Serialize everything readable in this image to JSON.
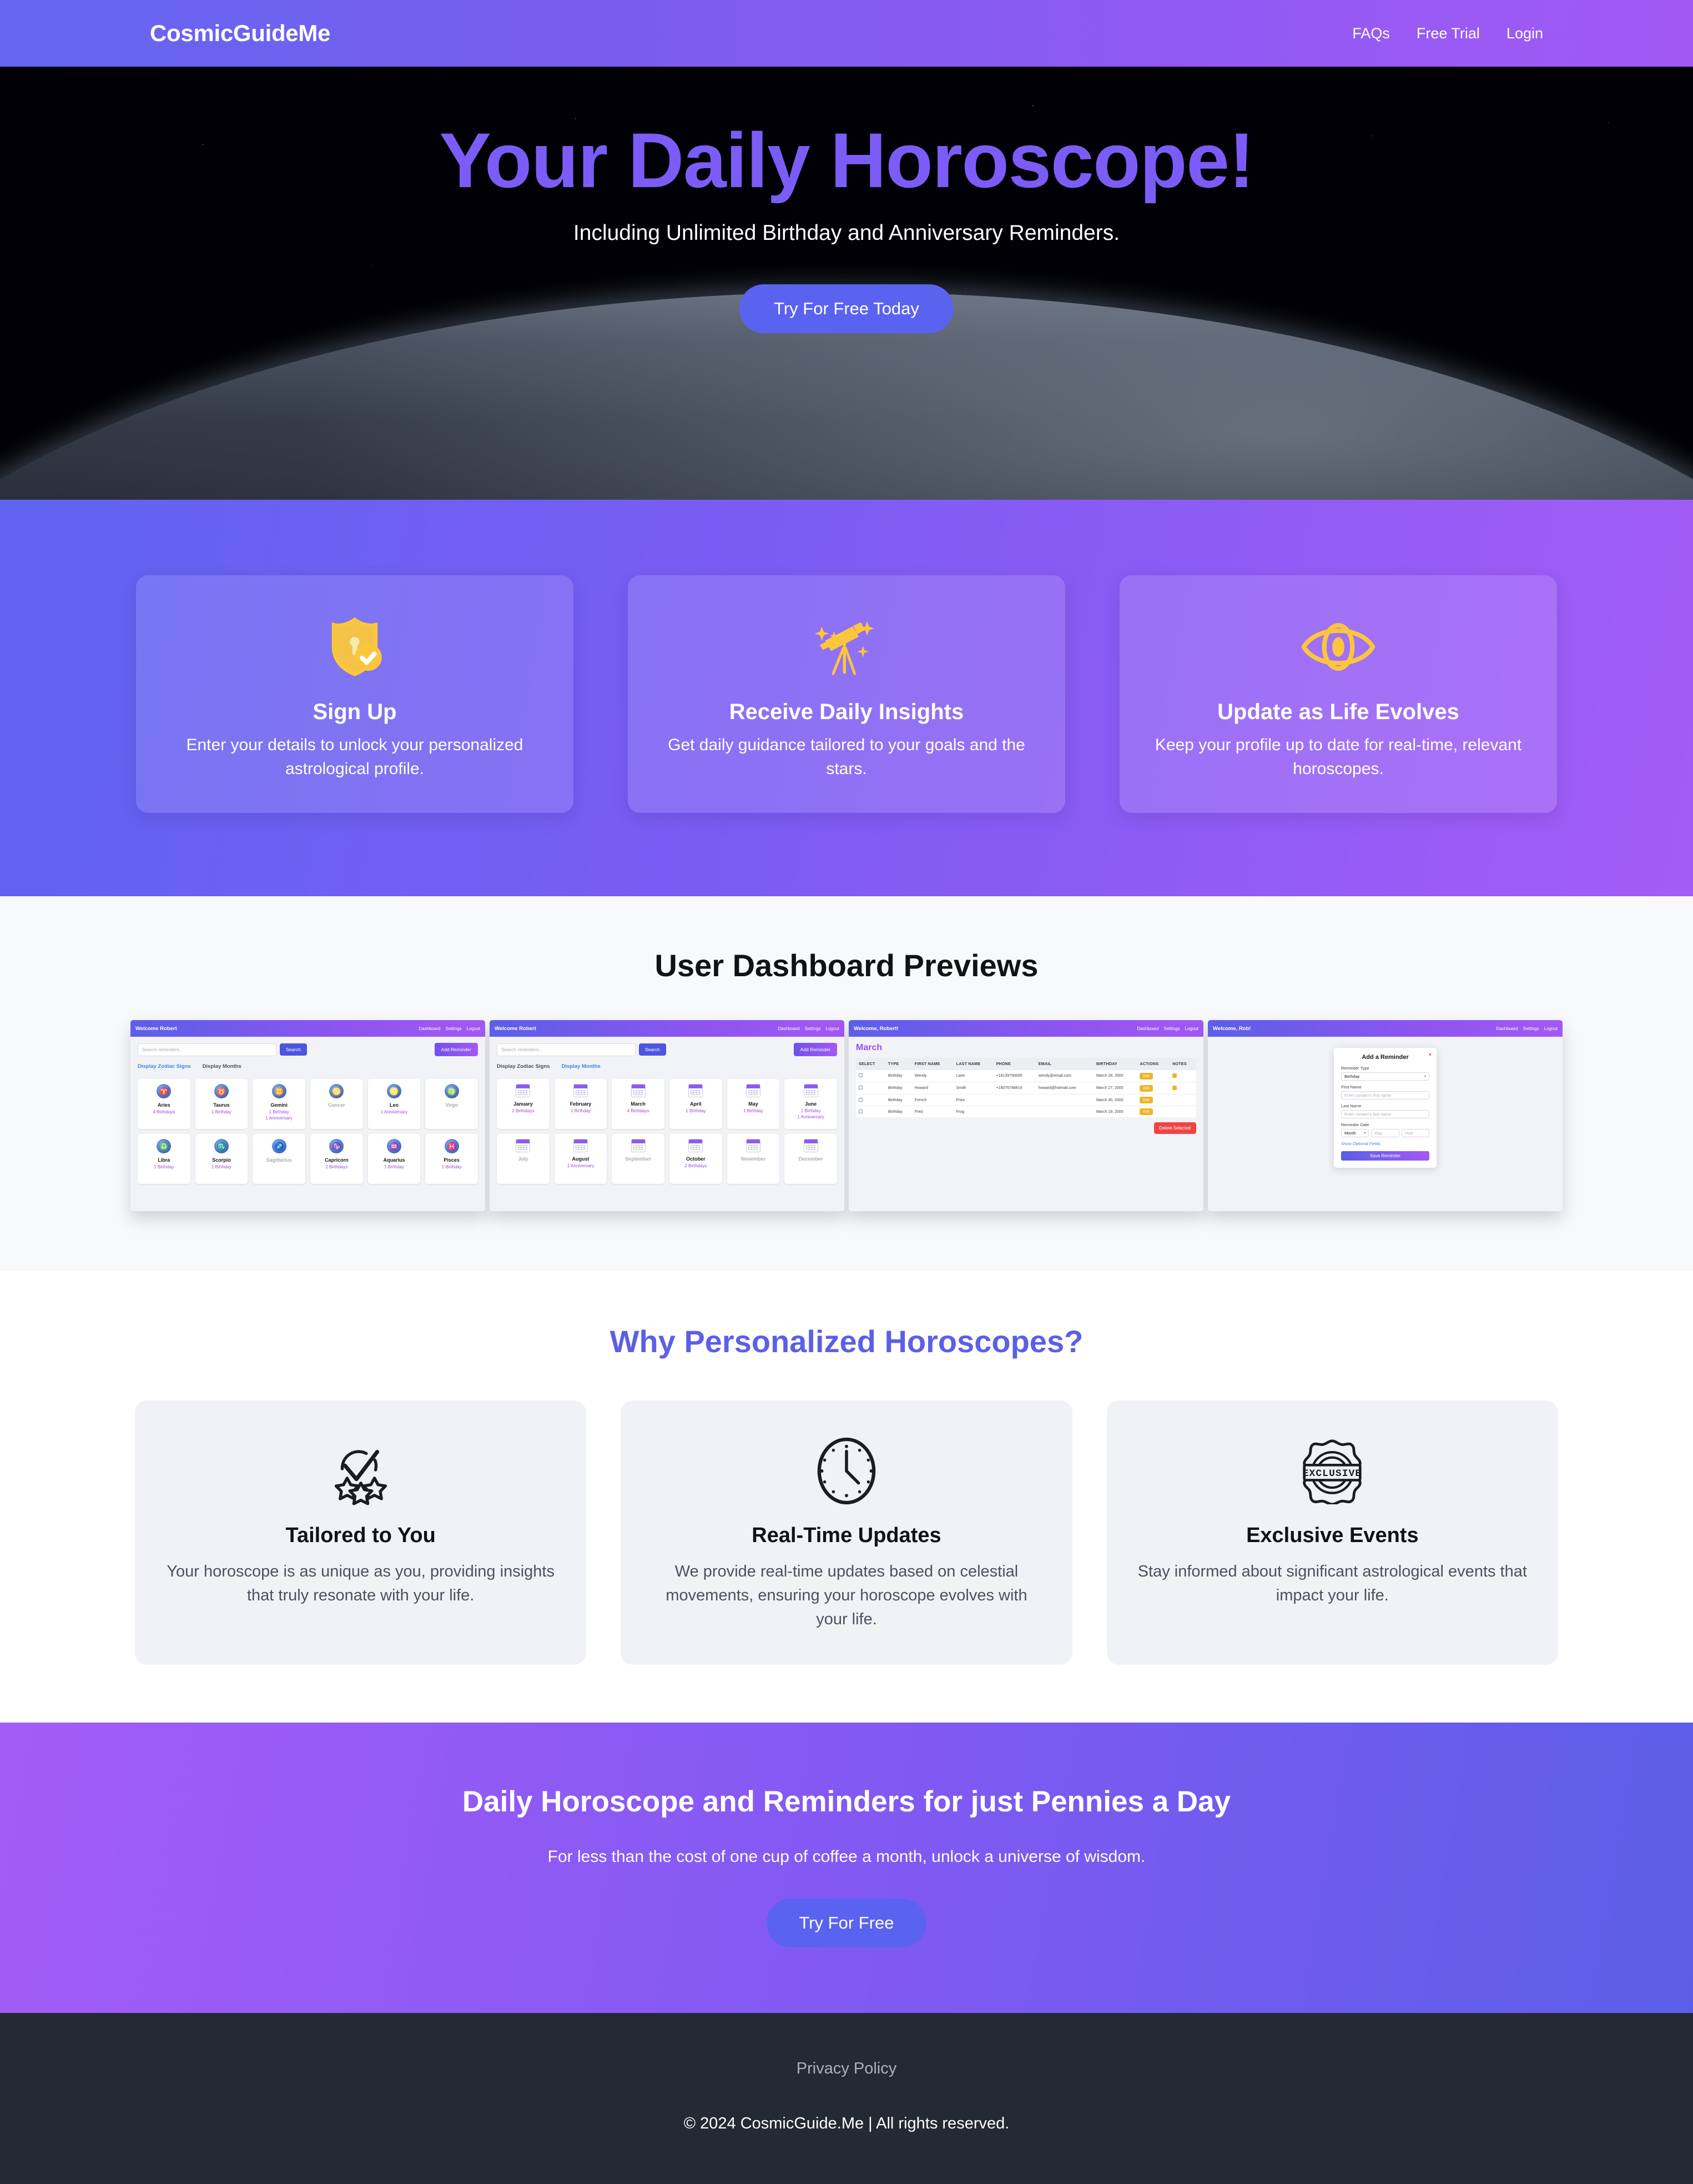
{
  "nav": {
    "brand": "CosmicGuideMe",
    "links": [
      "FAQs",
      "Free Trial",
      "Login"
    ]
  },
  "hero": {
    "title": "Your Daily Horoscope!",
    "subtitle": "Including Unlimited Birthday and Anniversary Reminders.",
    "cta": "Try For Free Today",
    "accent_color": "#7c5cf7",
    "button_color": "#5a63ef"
  },
  "steps": {
    "icon_color": "#fbc63c",
    "cards": [
      {
        "icon": "shield-check-icon",
        "title": "Sign Up",
        "desc": "Enter your details to unlock your personalized astrological profile."
      },
      {
        "icon": "telescope-stars-icon",
        "title": "Receive Daily Insights",
        "desc": "Get daily guidance tailored to your goals and the stars."
      },
      {
        "icon": "eye-icon",
        "title": "Update as Life Evolves",
        "desc": "Keep your profile up to date for real-time, relevant horoscopes."
      }
    ]
  },
  "previews": {
    "title": "User Dashboard Previews",
    "shot_zodiac": {
      "bar_title": "Welcome Robert",
      "bar_links": [
        "Dashboard",
        "Settings",
        "Logout"
      ],
      "search_placeholder": "Search reminders...",
      "search_button": "Search",
      "add_button": "Add Reminder",
      "tabs": [
        "Display Zodiac Signs",
        "Display Months"
      ],
      "active_tab": "Display Zodiac Signs",
      "tiles": [
        {
          "name": "Aries",
          "glyph": "♈",
          "meta": "4 Birthdays",
          "muted": false
        },
        {
          "name": "Taurus",
          "glyph": "♉",
          "meta": "1 Birthday",
          "muted": false
        },
        {
          "name": "Gemini",
          "glyph": "♊",
          "meta": "1 Birthday\n1 Anniversary",
          "muted": false
        },
        {
          "name": "Cancer",
          "glyph": "♋",
          "meta": "",
          "muted": true
        },
        {
          "name": "Leo",
          "glyph": "♌",
          "meta": "1 Anniversary",
          "muted": false
        },
        {
          "name": "Virgo",
          "glyph": "♍",
          "meta": "",
          "muted": true
        },
        {
          "name": "Libra",
          "glyph": "♎",
          "meta": "1 Birthday",
          "muted": false
        },
        {
          "name": "Scorpio",
          "glyph": "♏",
          "meta": "1 Birthday",
          "muted": false
        },
        {
          "name": "Sagittarius",
          "glyph": "♐",
          "meta": "",
          "muted": true
        },
        {
          "name": "Capricorn",
          "glyph": "♑",
          "meta": "2 Birthdays",
          "muted": false
        },
        {
          "name": "Aquarius",
          "glyph": "♒",
          "meta": "1 Birthday",
          "muted": false
        },
        {
          "name": "Pisces",
          "glyph": "♓",
          "meta": "1 Birthday",
          "muted": false
        }
      ]
    },
    "shot_months": {
      "bar_title": "Welcome Robert",
      "bar_links": [
        "Dashboard",
        "Settings",
        "Logout"
      ],
      "search_placeholder": "Search reminders...",
      "search_button": "Search",
      "add_button": "Add Reminder",
      "tabs": [
        "Display Zodiac Signs",
        "Display Months"
      ],
      "active_tab": "Display Months",
      "tiles": [
        {
          "name": "January",
          "meta": "2 Birthdays",
          "muted": false
        },
        {
          "name": "February",
          "meta": "1 Birthday",
          "muted": false
        },
        {
          "name": "March",
          "meta": "4 Birthdays",
          "muted": false
        },
        {
          "name": "April",
          "meta": "1 Birthday",
          "muted": false
        },
        {
          "name": "May",
          "meta": "1 Birthday",
          "muted": false
        },
        {
          "name": "June",
          "meta": "1 Birthday\n1 Anniversary",
          "muted": false
        },
        {
          "name": "July",
          "meta": "",
          "muted": true
        },
        {
          "name": "August",
          "meta": "1 Anniversary",
          "muted": false
        },
        {
          "name": "September",
          "meta": "",
          "muted": true
        },
        {
          "name": "October",
          "meta": "2 Birthdays",
          "muted": false
        },
        {
          "name": "November",
          "meta": "",
          "muted": true
        },
        {
          "name": "December",
          "meta": "",
          "muted": true
        }
      ]
    },
    "shot_table": {
      "bar_title": "Welcome, Robert!",
      "bar_links": [
        "Dashboard",
        "Settings",
        "Logout"
      ],
      "month": "March",
      "columns": [
        "SELECT",
        "TYPE",
        "FIRST NAME",
        "LAST NAME",
        "PHONE",
        "EMAIL",
        "BIRTHDAY",
        "ACTIONS",
        "NOTES"
      ],
      "rows": [
        {
          "type": "Birthday",
          "first": "Wendy",
          "last": "Lane",
          "phone": "+18139750000",
          "email": "wendy@email.com",
          "birthday": "March 28, 2000",
          "action": "Edit",
          "note": true
        },
        {
          "type": "Birthday",
          "first": "Howard",
          "last": "Smith",
          "phone": "+18076788819",
          "email": "howard@hotmail.com",
          "birthday": "March 27, 2000",
          "action": "Edit",
          "note": true
        },
        {
          "type": "Birthday",
          "first": "French",
          "last": "Fries",
          "phone": "",
          "email": "",
          "birthday": "March 30, 2000",
          "action": "Edit",
          "note": false
        },
        {
          "type": "Birthday",
          "first": "Fred",
          "last": "Frog",
          "phone": "",
          "email": "",
          "birthday": "March 19, 2000",
          "action": "Edit",
          "note": false
        }
      ],
      "delete_button": "Delete Selected"
    },
    "shot_modal": {
      "bar_title": "Welcome, Rob!",
      "bar_links": [
        "Dashboard",
        "Settings",
        "Logout"
      ],
      "modal_title": "Add a Reminder",
      "close": "×",
      "type_label": "Reminder Type",
      "type_value": "Birthday",
      "first_label": "First Name",
      "first_placeholder": "Enter contact's first name",
      "last_label": "Last Name",
      "last_placeholder": "Enter contact's last name",
      "date_label": "Reminder Date",
      "month_value": "Month",
      "day_placeholder": "Day",
      "year_placeholder": "Year",
      "optional_link": "Show Optional Fields",
      "save_button": "Save Reminder"
    }
  },
  "why": {
    "title": "Why Personalized Horoscopes?",
    "title_color": "#5b5fe8",
    "cards": [
      {
        "icon": "check-stars-icon",
        "title": "Tailored to You",
        "desc": "Your horoscope is as unique as you, providing insights that truly resonate with your life."
      },
      {
        "icon": "clock-icon",
        "title": "Real-Time Updates",
        "desc": "We provide real-time updates based on celestial movements, ensuring your horoscope evolves with your life."
      },
      {
        "icon": "exclusive-badge-icon",
        "title": "Exclusive Events",
        "desc": "Stay informed about significant astrological events that impact your life."
      }
    ],
    "badge_text": "EXCLUSIVE"
  },
  "cta": {
    "title": "Daily Horoscope and Reminders for just Pennies a Day",
    "subtitle": "For less than the cost of one cup of coffee a month, unlock a universe of wisdom.",
    "button": "Try For Free"
  },
  "footer": {
    "privacy": "Privacy Policy",
    "copyright": "© 2024 CosmicGuide.Me | All rights reserved."
  }
}
